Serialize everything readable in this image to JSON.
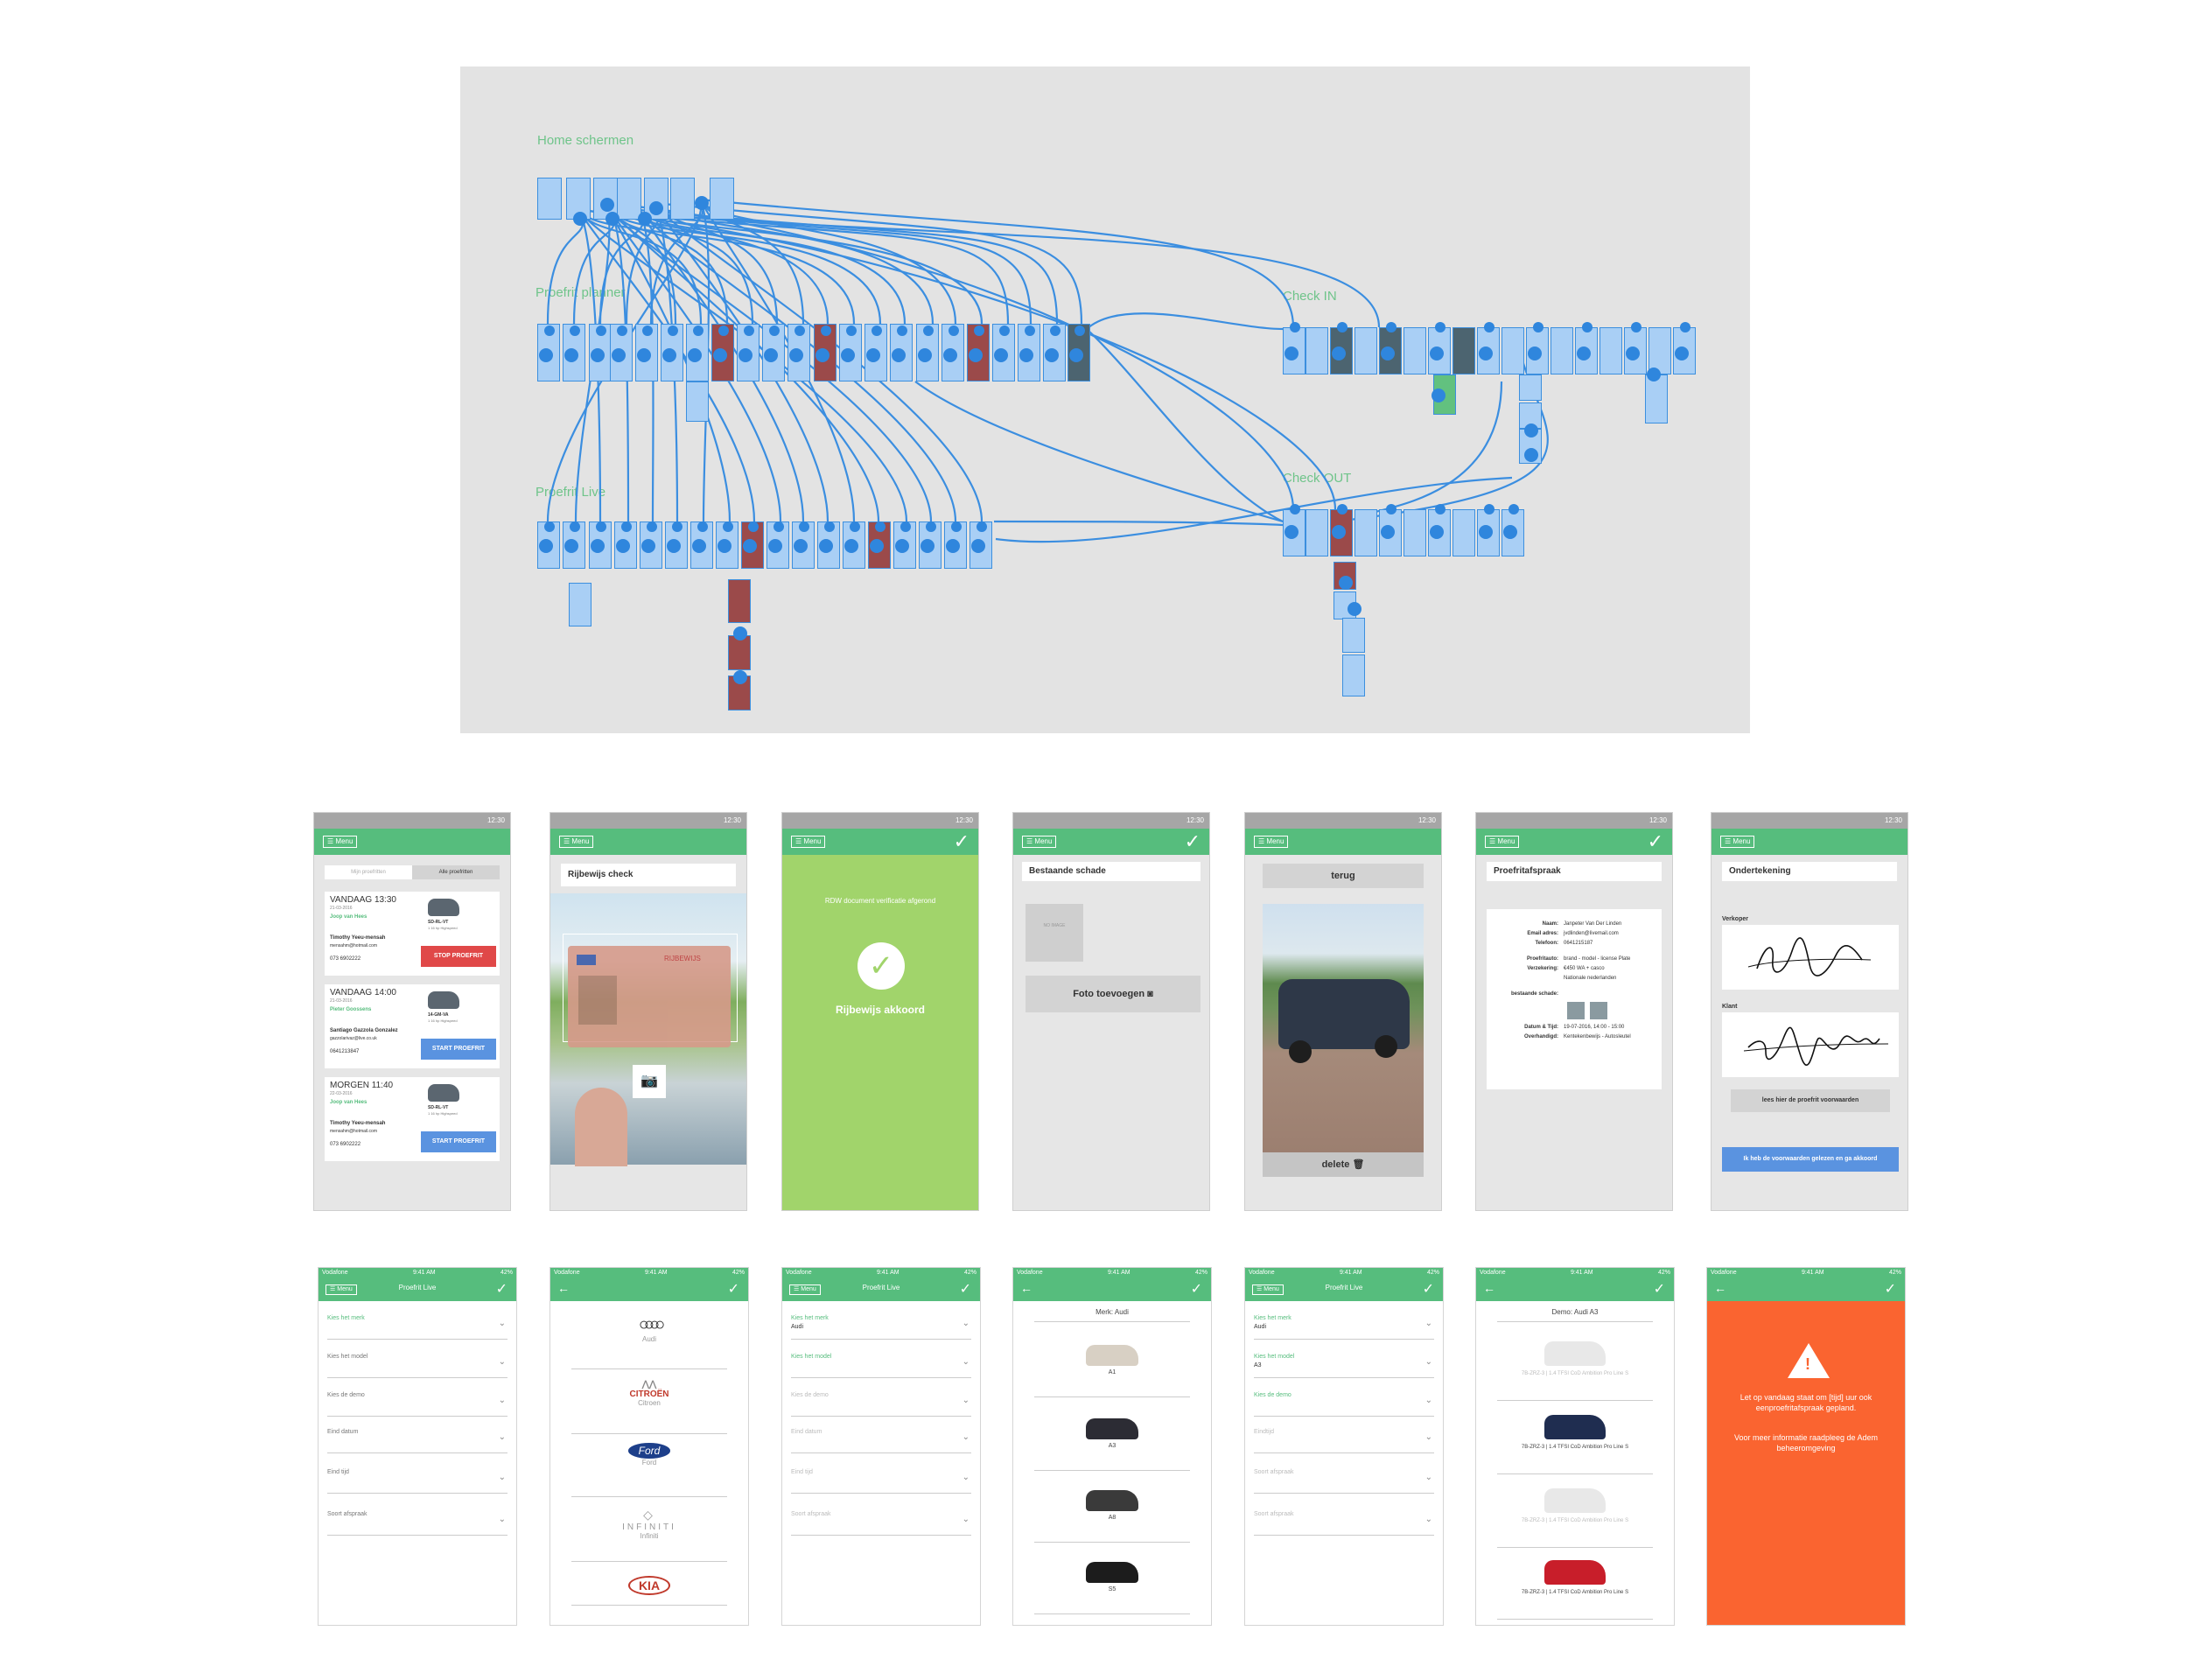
{
  "flow": {
    "sections": {
      "home": "Home schermen",
      "planner": "Proefrit planner",
      "live": "Proefrit Live",
      "checkin": "Check IN",
      "checkout": "Check OUT"
    }
  },
  "android": {
    "status_time": "12:30",
    "menu_label": "Menu",
    "screen1": {
      "tabs": [
        "Mijn proefritten",
        "Alle proefritten"
      ],
      "appointments": [
        {
          "when": "VANDAAG 13:30",
          "date": "21-03-2016",
          "agent": "Joop van Hees",
          "plate": "SD-RL-VT",
          "km": "1 16 hp Highspeed",
          "client": "Timothy Yeeu-mensah",
          "email": "mensahm@hotmail.com",
          "phone": "073 6902222",
          "action": "STOP PROEFRIT",
          "color": "#e04848"
        },
        {
          "when": "VANDAAG 14:00",
          "date": "21-03-2016",
          "agent": "Pieter Goossens",
          "plate": "14-GM-VA",
          "km": "1 16 hp Highspeed",
          "client": "Santiago Gazzola Gonzalez",
          "email": "gazzolarivaz@live.co.uk",
          "phone": "0641213847",
          "action": "START PROEFRIT",
          "color": "#5a93e0"
        },
        {
          "when": "MORGEN 11:40",
          "date": "22-03-2016",
          "agent": "Joop van Hees",
          "plate": "SD-RL-VT",
          "km": "1 16 hp Highspeed",
          "client": "Timothy Yeeu-mensah",
          "email": "mensahm@hotmail.com",
          "phone": "073 6902222",
          "action": "START PROEFRIT",
          "color": "#5a93e0"
        }
      ]
    },
    "screen2": {
      "title": "Rijbewijs check",
      "license_label": "RIJBEWIJS"
    },
    "screen3": {
      "message": "RDW document verificatie afgerond",
      "status": "Rijbewijs akkoord"
    },
    "screen4": {
      "title": "Bestaande schade",
      "add_photo": "Foto toevoegen",
      "placeholder": "NO IMAGE"
    },
    "screen5": {
      "back": "terug",
      "delete": "delete"
    },
    "screen6": {
      "title": "Proefritafspraak",
      "rows": [
        {
          "label": "Naam:",
          "value": "Janpeter Van Der Linden"
        },
        {
          "label": "Email adres:",
          "value": "jvdlinden@livemail.com"
        },
        {
          "label": "Telefoon:",
          "value": "0641215187"
        },
        {
          "label": "Proefritauto:",
          "value": "brand - model - license Plate"
        },
        {
          "label": "Verzekering:",
          "value": "€450 WA + casco"
        },
        {
          "label": "",
          "value": "Nationale nederlanden"
        },
        {
          "label": "bestaande schade:",
          "value": ""
        },
        {
          "label": "Datum & Tijd:",
          "value": "19-07-2016, 14:00 - 15:00"
        },
        {
          "label": "Overhandigd:",
          "value": "Kentekenbewijs - Autosleutel"
        }
      ]
    },
    "screen7": {
      "title": "Ondertekening",
      "seller": "Verkoper",
      "client": "Klant",
      "read_terms": "lees hier de proefrit voorwaarden",
      "agree": "Ik heb de voorwaarden gelezen en ga akkoord"
    }
  },
  "ios": {
    "carrier": "Vodafone",
    "time": "9:41 AM",
    "battery": "42%",
    "title": "Proefrit Live",
    "menu_label": "Menu",
    "form_labels": [
      "Kies het merk",
      "Kies het model",
      "Kies de demo",
      "Eind datum",
      "Eind tijd",
      "Soort afspraak"
    ],
    "form3_values": [
      "Audi",
      "",
      "",
      "",
      "",
      ""
    ],
    "form5_values": [
      "Audi",
      "A3",
      "",
      "",
      "",
      ""
    ],
    "form5_labels": [
      "Kies het merk",
      "Kies het model",
      "Kies de demo",
      "Eindtijd",
      "Soort afspraak",
      "Soort afspraak"
    ],
    "brands": [
      "Audi",
      "Citroen",
      "Ford",
      "Infiniti",
      "Kia"
    ],
    "brand_logos": [
      "audi-rings",
      "CITROËN",
      "Ford",
      "INFINITI",
      "KIA"
    ],
    "models_title": "Merk: Audi",
    "models": [
      "A1",
      "A3",
      "A8",
      "S5"
    ],
    "demos_title": "Demo: Audi A3",
    "demos": [
      "7B-ZRZ-3 | 1.4 TFSI CoD Ambition Pro Line S",
      "7B-ZRZ-3 | 1.4 TFSI CoD Ambition Pro Line S",
      "7B-ZRZ-3 | 1.4 TFSI CoD Ambition Pro Line S",
      "7B-ZRZ-3 | 1.4 TFSI CoD Ambition Pro Line S"
    ],
    "warning_line1": "Let op vandaag staat om [tijd] uur ook eenproefritafspraak gepland.",
    "warning_line2": "Voor meer informatie raadpleeg de Adem beheeromgeving"
  },
  "colors": {
    "green": "#56bd7d",
    "blue": "#2f86dd",
    "orange": "#fa6430",
    "red": "#e04848",
    "lime": "#a1d46b"
  }
}
